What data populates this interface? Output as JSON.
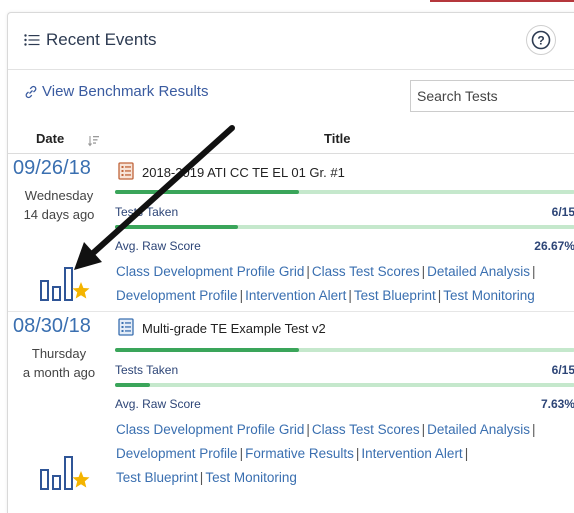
{
  "panel": {
    "title": "Recent Events",
    "help_label": "?",
    "benchmark_link": "View Benchmark Results",
    "search": {
      "placeholder": "Search Tests",
      "value": ""
    }
  },
  "table": {
    "col_date": "Date",
    "col_title": "Title"
  },
  "events": [
    {
      "date": "09/26/18",
      "weekday": "Wednesday",
      "ago": "14 days ago",
      "title": "2018-2019 ATI CC TE EL 01 Gr. #1",
      "tests_taken_label": "Tests Taken",
      "tests_taken_value": "6/15",
      "tests_taken_fraction": 0.4,
      "avg_label": "Avg. Raw Score",
      "avg_value": "26.67%",
      "avg_fraction": 0.2667,
      "links": [
        "Class Development Profile Grid",
        "Class Test Scores",
        "Detailed Analysis",
        "Development Profile",
        "Intervention Alert",
        "Test Blueprint",
        "Test Monitoring"
      ]
    },
    {
      "date": "08/30/18",
      "weekday": "Thursday",
      "ago": "a month ago",
      "title": "Multi-grade TE Example Test v2",
      "tests_taken_label": "Tests Taken",
      "tests_taken_value": "6/15",
      "tests_taken_fraction": 0.4,
      "avg_label": "Avg. Raw Score",
      "avg_value": "7.63%",
      "avg_fraction": 0.0763,
      "links": [
        "Class Development Profile Grid",
        "Class Test Scores",
        "Detailed Analysis",
        "Development Profile",
        "Formative Results",
        "Intervention Alert",
        "Test Blueprint",
        "Test Monitoring"
      ]
    }
  ],
  "colors": {
    "accent": "#3a6fb0",
    "bar_fill": "#3aa55a",
    "bar_track": "#c5e8cc",
    "star": "#f4b400"
  }
}
